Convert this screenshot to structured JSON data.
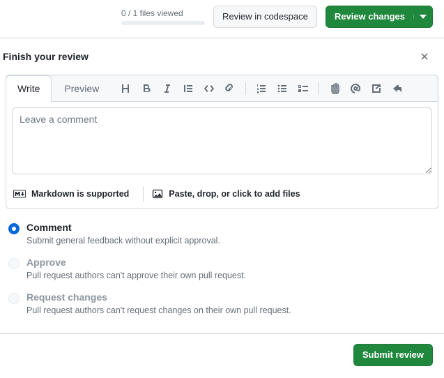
{
  "topbar": {
    "files_viewed_label": "0 / 1 files viewed",
    "review_codespace_label": "Review in codespace",
    "review_changes_label": "Review changes"
  },
  "panel": {
    "title": "Finish your review",
    "tab_write": "Write",
    "tab_preview": "Preview",
    "comment_placeholder": "Leave a comment",
    "comment_value": "",
    "markdown_label": "Markdown is supported",
    "files_hint": "Paste, drop, or click to add files"
  },
  "options": {
    "comment": {
      "label": "Comment",
      "desc": "Submit general feedback without explicit approval."
    },
    "approve": {
      "label": "Approve",
      "desc": "Pull request authors can't approve their own pull request."
    },
    "request": {
      "label": "Request changes",
      "desc": "Pull request authors can't request changes on their own pull request."
    }
  },
  "footer": {
    "submit_label": "Submit review"
  }
}
